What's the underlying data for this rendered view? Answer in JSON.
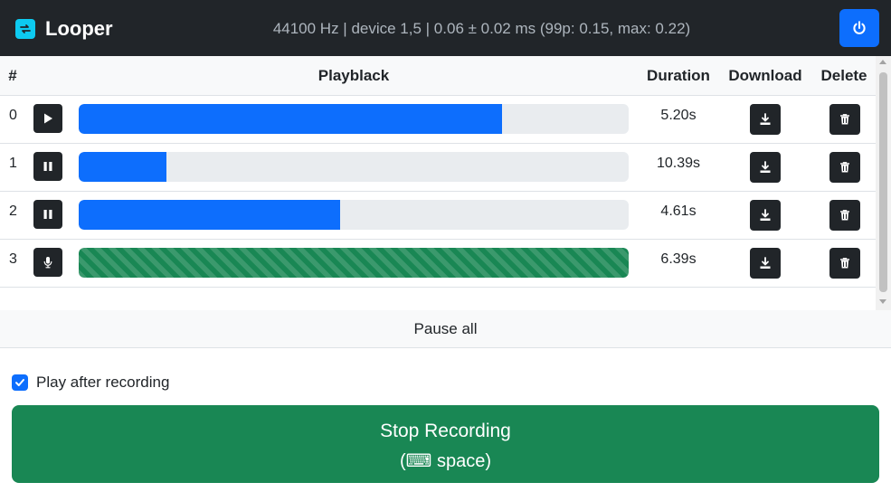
{
  "app": {
    "title": "Looper",
    "stats": "44100 Hz | device 1,5 | 0.06 ± 0.02 ms (99p: 0.15, max: 0.22)",
    "accent_color": "#0d6efd",
    "record_color": "#198754",
    "power_icon": "power-icon"
  },
  "table": {
    "headers": {
      "index": "#",
      "playback": "Playblack",
      "duration": "Duration",
      "download": "Download",
      "delete": "Delete"
    },
    "rows": [
      {
        "index": "0",
        "state": "play-icon",
        "progress": 0.77,
        "duration": "5.20s",
        "recording": false
      },
      {
        "index": "1",
        "state": "pause-icon",
        "progress": 0.16,
        "duration": "10.39s",
        "recording": false
      },
      {
        "index": "2",
        "state": "pause-icon",
        "progress": 0.475,
        "duration": "4.61s",
        "recording": false
      },
      {
        "index": "3",
        "state": "mic-icon",
        "progress": 1.0,
        "duration": "6.39s",
        "recording": true
      }
    ]
  },
  "controls": {
    "pause_all": "Pause all",
    "play_after_recording_label": "Play after recording",
    "play_after_recording_checked": true,
    "stop_recording_label": "Stop Recording",
    "stop_recording_hint": "(⌨ space)"
  }
}
